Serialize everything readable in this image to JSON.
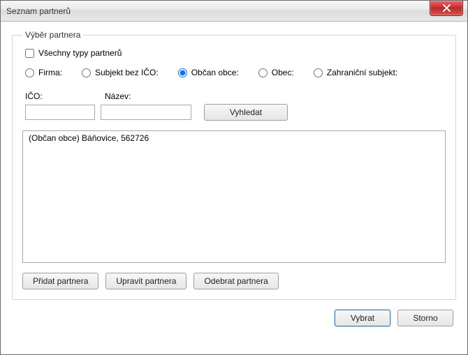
{
  "window": {
    "title": "Seznam partnerů"
  },
  "group": {
    "legend": "Výběr partnera"
  },
  "checkbox": {
    "all_types_label": "Všechny typy partnerů",
    "checked": false
  },
  "radios": {
    "firma": "Firma:",
    "subjekt_bez_ico": "Subjekt bez IČO:",
    "obcan_obce": "Občan obce:",
    "obec": "Obec:",
    "zahranicni": "Zahraniční subjekt:",
    "selected": "obcan_obce"
  },
  "fields": {
    "ico_label": "IČO:",
    "nazev_label": "Název:",
    "ico_value": "",
    "nazev_value": ""
  },
  "buttons": {
    "search": "Vyhledat",
    "add": "Přidat partnera",
    "edit": "Upravit partnera",
    "remove": "Odebrat partnera",
    "select": "Vybrat",
    "cancel": "Storno"
  },
  "list": {
    "items": [
      "(Občan obce) Báňovice, 562726"
    ]
  }
}
